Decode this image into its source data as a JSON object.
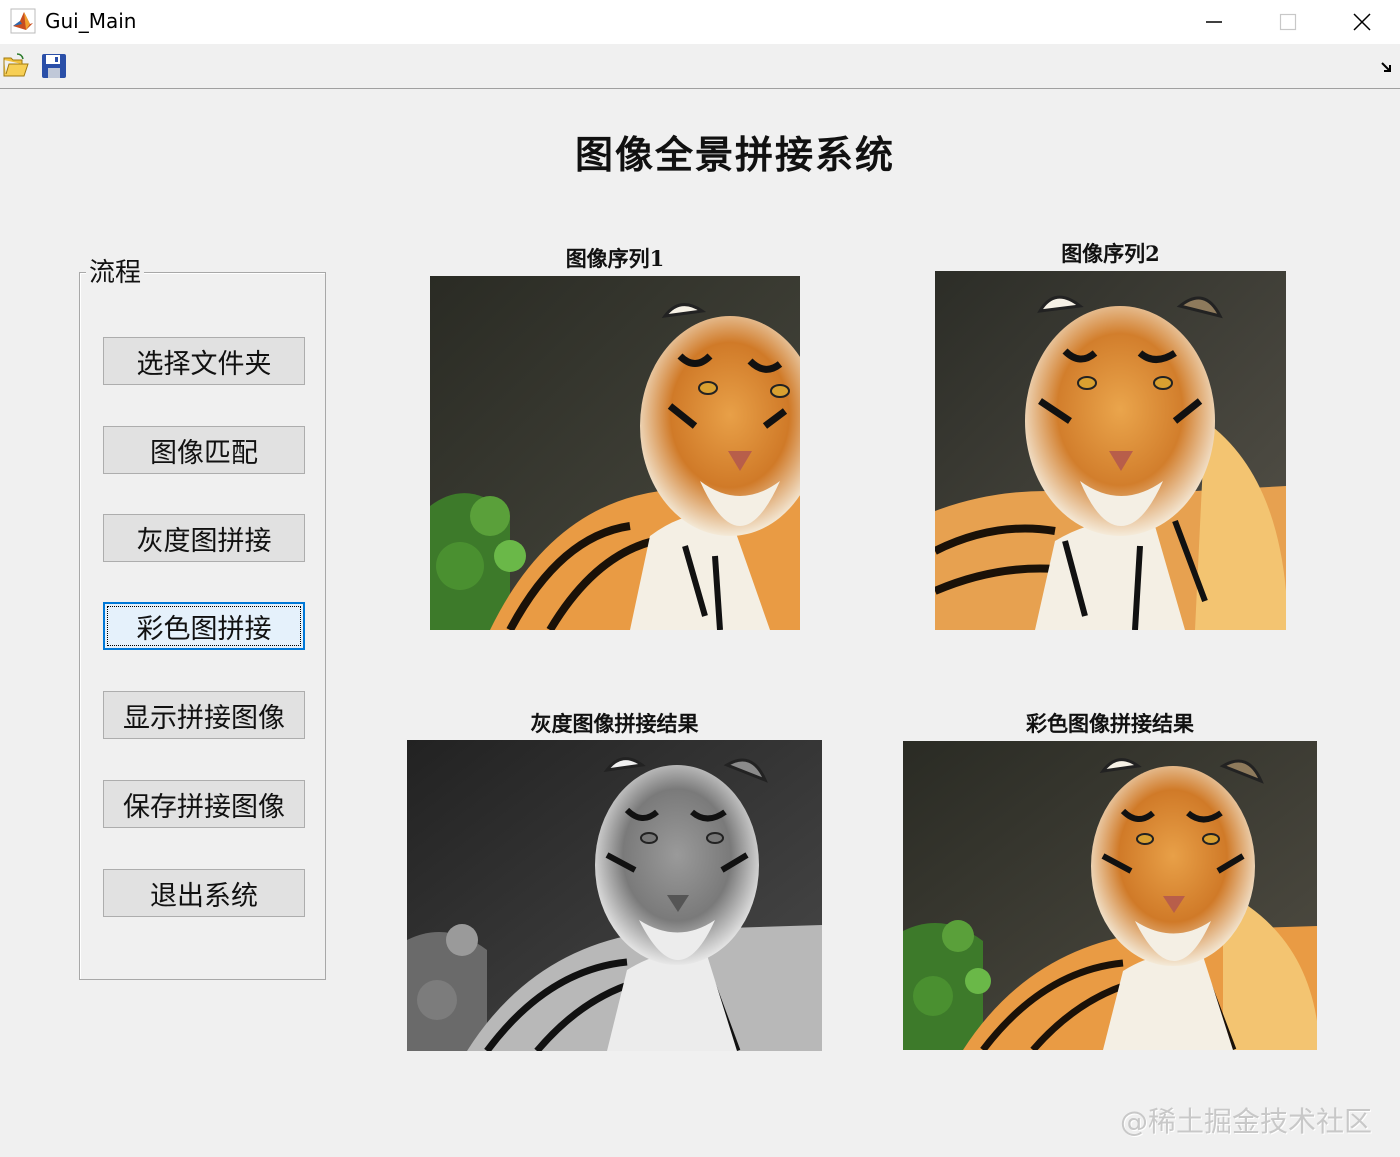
{
  "window": {
    "title": "Gui_Main",
    "app_icon": "matlab-icon",
    "controls": [
      "minimize-icon",
      "maximize-icon",
      "close-icon"
    ]
  },
  "toolbar": {
    "open_icon": "open-folder-icon",
    "save_icon": "save-disk-icon"
  },
  "heading": "图像全景拼接系统",
  "panel": {
    "legend": "流程",
    "buttons": [
      {
        "label": "选择文件夹"
      },
      {
        "label": "图像匹配"
      },
      {
        "label": "灰度图拼接"
      },
      {
        "label": "彩色图拼接",
        "focused": true
      },
      {
        "label": "显示拼接图像"
      },
      {
        "label": "保存拼接图像"
      },
      {
        "label": "退出系统"
      }
    ]
  },
  "images": {
    "seq1": {
      "caption": "图像序列1",
      "content": "tiger-color"
    },
    "seq2": {
      "caption": "图像序列2",
      "content": "tiger-color"
    },
    "gray_result": {
      "caption": "灰度图像拼接结果",
      "content": "tiger-grayscale"
    },
    "color_result": {
      "caption": "彩色图像拼接结果",
      "content": "tiger-color"
    }
  },
  "watermark": "@稀土掘金技术社区",
  "colors": {
    "background": "#f0f0f0",
    "button_face": "#e1e1e1",
    "focus_border": "#0078d7"
  }
}
